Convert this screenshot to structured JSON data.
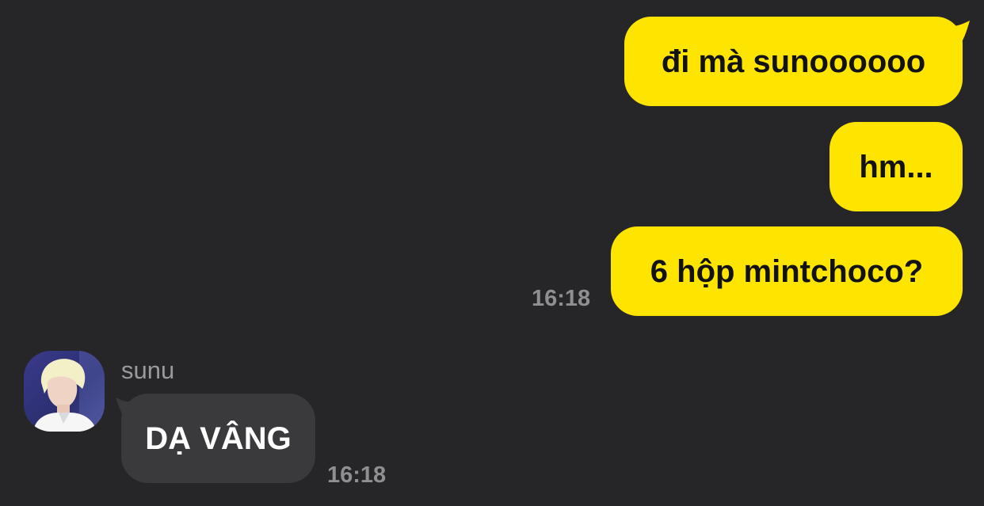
{
  "colors": {
    "background": "#262628",
    "sent_bubble": "#FEE500",
    "sent_text": "#121212",
    "received_bubble": "#3A3A3C",
    "received_text": "#FFFFFF",
    "timestamp": "#8E8E93",
    "sender_name": "#9A9A9E"
  },
  "messages": {
    "sent": [
      {
        "text": "đi mà sunoooooo"
      },
      {
        "text": "hm..."
      },
      {
        "text": "6 hộp mintchoco?",
        "time": "16:18"
      }
    ],
    "received": [
      {
        "sender": "sunu",
        "avatar_icon": "profile-photo",
        "text": "DẠ VÂNG",
        "time": "16:18"
      }
    ]
  }
}
